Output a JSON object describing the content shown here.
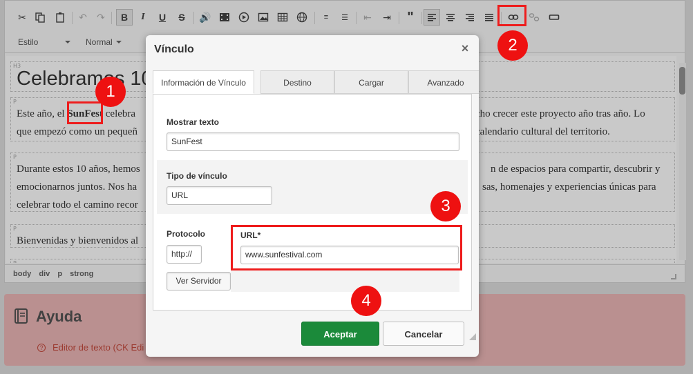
{
  "toolbar": {
    "style_combo": "Estilo",
    "format_combo": "Normal"
  },
  "content": {
    "heading": "Celebramos 10",
    "p1_line1_before": "Este año, el ",
    "p1_bold": "SunFest",
    "p1_line1_after": " celebra",
    "p1_line1_right": "cho crecer este proyecto año tras año. Lo",
    "p1_line2_left": "que empezó como un pequeñ",
    "p1_line2_right": "calendario cultural del territorio.",
    "p2_line1_left": "Durante estos 10 años, hemos",
    "p2_line1_right": "n de espacios para compartir, descubrir y",
    "p2_line2_left": "emocionarnos juntos. Nos ha",
    "p2_line2_right": "sas, homenajes y experiencias únicas para",
    "p2_line3_left": "celebrar todo el camino recor",
    "p3_line1_left": "Bienvenidas y bienvenidos al",
    "tag_h3": "H3",
    "tag_p": "P"
  },
  "pathbar": [
    "body",
    "div",
    "p",
    "strong"
  ],
  "help": {
    "title": "Ayuda",
    "link": "Editor de texto (CK Edi"
  },
  "dialog": {
    "title": "Vínculo",
    "close": "×",
    "tabs": [
      "Información de Vínculo",
      "Destino",
      "Cargar",
      "Avanzado"
    ],
    "display_text_label": "Mostrar texto",
    "display_text_value": "SunFest",
    "link_type_label": "Tipo de vínculo",
    "link_type_value": "URL",
    "protocol_label": "Protocolo",
    "protocol_value": "http://",
    "url_label": "URL*",
    "url_value": "www.sunfestival.com",
    "browse_button": "Ver Servidor",
    "accept_button": "Aceptar",
    "cancel_button": "Cancelar"
  },
  "annotations": [
    "1",
    "2",
    "3",
    "4"
  ],
  "colors": {
    "annotation_red": "#ee1c1c",
    "accept_green": "#1b8a3a",
    "help_bg": "#ebb1b1"
  }
}
